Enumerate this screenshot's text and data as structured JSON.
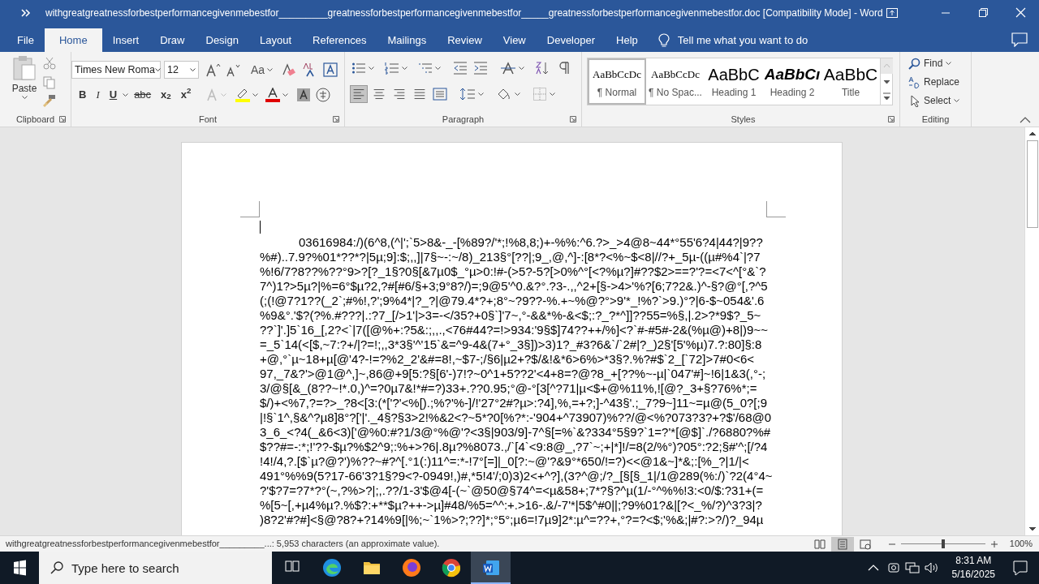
{
  "window": {
    "title": "withgreatgreatnessforbestperformancegivenmebestfor_________greatnessforbestperformancegivenmebestfor_____greatnessforbestperformancegivenmebestfor.doc [Compatibility Mode]  -  Word"
  },
  "tabs": [
    {
      "label": "File",
      "selected": false
    },
    {
      "label": "Home",
      "selected": true
    },
    {
      "label": "Insert",
      "selected": false
    },
    {
      "label": "Draw",
      "selected": false
    },
    {
      "label": "Design",
      "selected": false
    },
    {
      "label": "Layout",
      "selected": false
    },
    {
      "label": "References",
      "selected": false
    },
    {
      "label": "Mailings",
      "selected": false
    },
    {
      "label": "Review",
      "selected": false
    },
    {
      "label": "View",
      "selected": false
    },
    {
      "label": "Developer",
      "selected": false
    },
    {
      "label": "Help",
      "selected": false
    }
  ],
  "tell_me": {
    "placeholder": "Tell me what you want to do"
  },
  "ribbon": {
    "clipboard": {
      "paste": "Paste",
      "label": "Clipboard"
    },
    "font": {
      "name": "Times New Roma",
      "size": "12",
      "label": "Font",
      "case_button": "Aa",
      "format_buttons": [
        "B",
        "I",
        "U",
        "abc",
        "x$_{2}$",
        "x$^{2}$"
      ]
    },
    "paragraph": {
      "label": "Paragraph",
      "alignments": [
        {
          "kind": "left",
          "selected": true
        },
        {
          "kind": "center",
          "selected": false
        },
        {
          "kind": "right",
          "selected": false
        },
        {
          "kind": "justify",
          "selected": false
        }
      ]
    },
    "styles": {
      "label": "Styles",
      "items": [
        {
          "preview": "AaBbCcDc",
          "name": "¶ Normal",
          "kind": "normal",
          "selected": true
        },
        {
          "preview": "AaBbCcDc",
          "name": "¶ No Spac...",
          "kind": "normal",
          "selected": false
        },
        {
          "preview": "AaBbC",
          "name": "Heading 1",
          "kind": "heading",
          "selected": false
        },
        {
          "preview": "AaBbCı",
          "name": "Heading 2",
          "kind": "heading-italic",
          "selected": false
        },
        {
          "preview": "AaBbC",
          "name": "Title",
          "kind": "title",
          "selected": false
        }
      ]
    },
    "editing": {
      "label": "Editing",
      "items": [
        {
          "kind": "find",
          "label": "Find"
        },
        {
          "kind": "replace",
          "label": "Replace"
        },
        {
          "kind": "select",
          "label": "Select"
        }
      ]
    }
  },
  "document": {
    "lines": [
      "03616984:/)(6^8,(^|';`5>8&-_-[%89?/'*;!%8,8;)+-%%:^6.?>_>4@8~44*°55'6?4|44?|9??",
      "%#)..7.9?%01*??*?|5µ;9]:$;,,]|7§~-:~/8)_213§°[??|;9_,@,^]-:[8*?<%~$<8|//?+_5µ-((µ#%4`|?7",
      "%!6/7?8??%??°9>?[?_1§?0§[&7µ0$_°µ>0:!#-(>5?-5?[>0%^°[<?%µ?]#??$2>==?'?=<7<^[°&`?",
      "7^)1?>5µ?|%=6°$µ?2,?#[#6/§+3;9°8?/)=;9@5'^0.&?°.?3-.,,^2+[§->4>'%?[6;7?2&.)^-§?@°[,?^5",
      "(;(!@7?1??(_2`;#%!,?';9%4*|?_?|@79.4*?+;8°~?9??-%.+~%@?°>9'*_!%?`>9.)°?|6-$~054&'.6",
      "%9&°.'$?(?%.#???|.:?7_[/>1'|>3=-</35?+0§`]'7~,°-&&*%-&<$;:?_?*^]]??55=%§,|.2>?*9$?_5~",
      "??`]'.]5`16_[,2?<`|7([@%+:?5&:;,,.,<76#44?=!>934:'9§$]74??++/%]<?`#-#5#-2&(%µ@)+8|)9~~",
      "=_5`14(<[$,~7:?+/|?=!;,,3*3§'^'15`&=^9-4&(7+°_3§])>3)1?_#3?6&`/`2#|?_)2§'[5'%µ)7.?:80]§:8",
      "+@,°`µ~18+µ[@'4?-!=?%2_2'&#=8!,~$7-;/§6|µ2+?$/&!&*6>6%>*3§?.%?#$`2_[`72]>7#0<6<",
      "97,_7&?'>@1@^,]~,86@+9[5:?§[6'-)7!?~0^1+5??2'<4+8=?@?8_+[??%~-µ|`047'#]~!6|1&3(,°-;",
      "3/@§[&_(8??~!*.0,)^=?0µ7&!*#=?)33+.??0.95;°@-°[3[^?71|µ<$+@%11%,![@?_3+§?76%*;=",
      "$/)+<%7,?=?>_?8<[3:(*['?'<%[).;%?'%-]/!'27°2#?µ>:?4],%,=+?;]-^43§'.;_7?9~]11~=µ@(5_0?[;9",
      "|!§`1^,§&^?µ8]8°?['|'._4§?§3>2!%&2<?~5*?0[%?*:-'904+^73907)%??/@<%?073?3?+?$'/68@0",
      "3_6_<?4(_&6<3)['@%0:#?1/3@°%@'?<3§|903/9]-7^§[=%`&?334°5§9?`1=?'*[@$]`./?6880?%#",
      "$??#=-:*;!'??-$µ?%$2^9;:%+>?6|.8µ?%8073.,/`[4`<9:8@_,?7`~;+|*]!/=8(2/%°)?05°:?2;§#'^;[/?4",
      "!4!/4,?.[$`µ?@?')%??~#?^[.°1(:)11^=:*-!7°[=]|_0[?:~@'?&9°*650/!=?)<<@1&~]*&;:[%_?|1/|<",
      "491°%%9(5?17-66'3?1§?9<?-0949!,)#,*5!4'/;0)3)2<+^?],(3?^@;/?_[§[§_1|/1@289(%:/)`?2(4°4~",
      "?'$?7=?7*?°(~,?%>?|;,.??/1-3'$@4[-(~`@50@§74^=<µ&58+;7*?§?^µ(1/-°^%%!3:<0/$:?31+(=",
      "%[5~[,+µ4%µ?.%$?:+**$µ?++->µ]#48/%5=^^:+.>16-.&/-7'*|5$^#0||;?9%01?&|[?<_%/?)^3?3|?",
      ")8?2'#?#]<§@?8?+?14%9[|%;~`1%>?;??]*;°5°;µ6=!7µ9]2*:µ^=??+,°?=?<$;'%&;|#?:>?/)?_94µ"
    ]
  },
  "status_bar": {
    "text": "withgreatgreatnessforbestperformancegivenmebestfor_________...: 5,953 characters (an approximate value).",
    "views": [
      {
        "kind": "read",
        "selected": false
      },
      {
        "kind": "print",
        "selected": true
      },
      {
        "kind": "web",
        "selected": false
      }
    ],
    "zoom": {
      "level": 0.5,
      "label": "100%"
    }
  },
  "taskbar": {
    "search": {
      "placeholder": "Type here to search"
    },
    "apps": [
      {
        "kind": "task-view",
        "selected": false
      },
      {
        "kind": "edge",
        "selected": false
      },
      {
        "kind": "explorer",
        "selected": false
      },
      {
        "kind": "firefox",
        "selected": false
      },
      {
        "kind": "chrome",
        "selected": false
      },
      {
        "kind": "word",
        "selected": true
      }
    ],
    "time": "8:31 AM",
    "date": "5/16/2025"
  }
}
